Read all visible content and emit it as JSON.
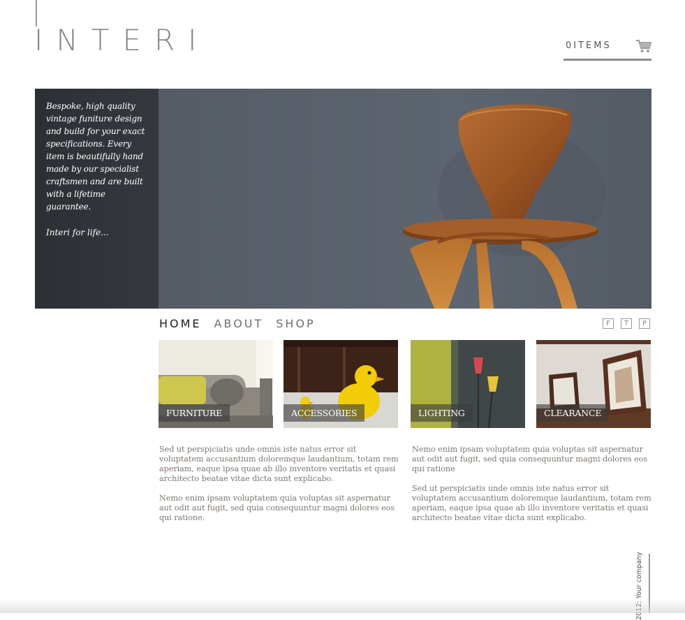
{
  "header": {
    "logo": "INTERI",
    "cart_label": "0ITEMS",
    "cart_icon": "shopping-cart-icon"
  },
  "hero": {
    "description": "Bespoke, high quality vintage funiture design and build for your exact specifications. Every item is beautifully hand made by our specialist craftsmen and are built with a lifetime guarantee.",
    "tagline": "Interi for life..."
  },
  "nav": {
    "items": [
      {
        "label": "HOME",
        "active": true
      },
      {
        "label": "ABOUT",
        "active": false
      },
      {
        "label": "SHOP",
        "active": false
      }
    ],
    "social": [
      "F",
      "T",
      "P"
    ]
  },
  "categories": [
    {
      "label": "FURNITURE"
    },
    {
      "label": "ACCESSORIES"
    },
    {
      "label": "LIGHTING"
    },
    {
      "label": "CLEARANCE"
    }
  ],
  "content": {
    "left": [
      "Sed ut perspiciatis unde omnis iste natus error sit voluptatem accusantium doloremque laudantium, totam rem aperiam, eaque ipsa quae ab illo inventore veritatis et quasi architecto beatae vitae dicta sunt explicabo.",
      "Nemo enim ipsam voluptatem quia voluptas sit aspernatur aut odit aut fugit, sed quia consequuntur magni dolores eos qui ratione."
    ],
    "right": [
      "Nemo enim ipsam voluptatem quia voluptas sit aspernatur aut odit aut fugit, sed quia consequuntur magni dolores eos qui ratione",
      "Sed ut perspiciatis unde omnis iste natus error sit voluptatem accusantium doloremque laudantium, totam rem aperiam, eaque ipsa quae ab illo inventore veritatis et quasi architecto beatae vitae dicta sunt explicabo."
    ]
  },
  "footer": {
    "copyright": "2012: Your company"
  }
}
